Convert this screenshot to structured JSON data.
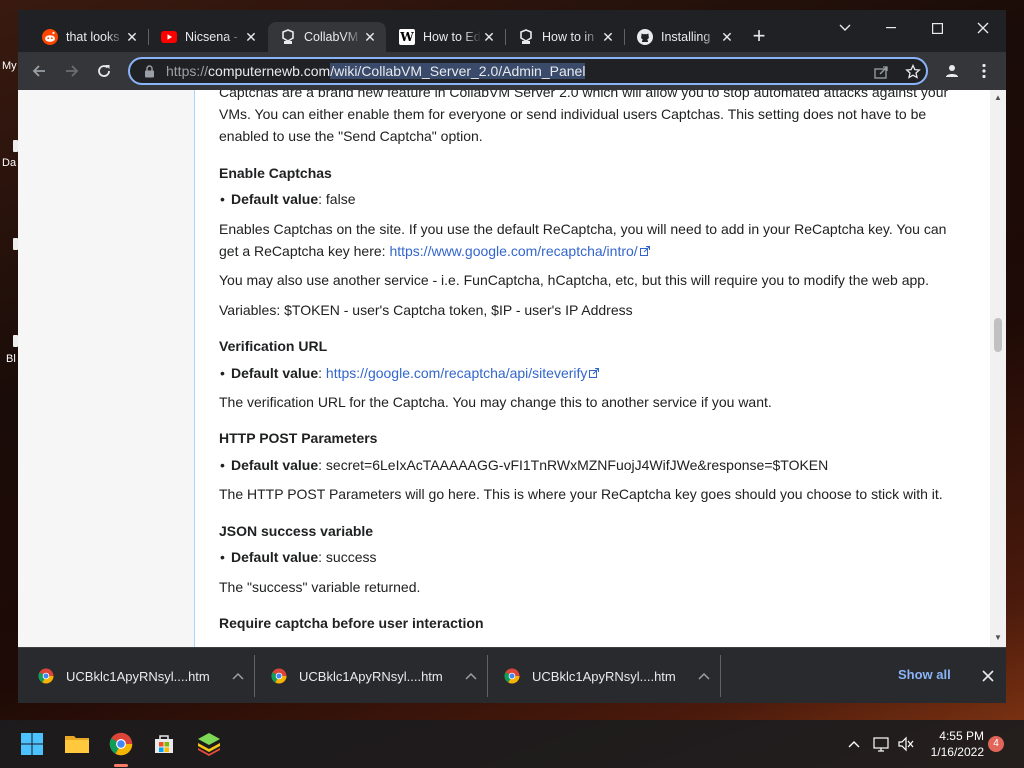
{
  "desktop": {
    "edge_labels": [
      "My",
      "Da",
      "Bl"
    ]
  },
  "tabs": [
    {
      "title": "that looks",
      "icon": "reddit-icon"
    },
    {
      "title": "Nicsena -",
      "icon": "youtube-icon"
    },
    {
      "title": "CollabVM",
      "icon": "collabvm-icon",
      "active": true
    },
    {
      "title": "How to Ed",
      "icon": "wikipedia-icon"
    },
    {
      "title": "How to in",
      "icon": "collabvm-icon"
    },
    {
      "title": "Installing",
      "icon": "github-icon"
    }
  ],
  "address_bar": {
    "scheme": "https://",
    "host": "computernewb.com",
    "path": "/wiki/CollabVM_Server_2.0/Admin_Panel"
  },
  "article": {
    "intro_line1": "Captchas are a brand new feature in CollabVM Server 2.0 which will allow you to stop automated attacks against your",
    "intro_line2": "VMs. You can either enable them for everyone or send individual users Captchas. This setting does not have to be",
    "intro_line3": "enabled to use the \"Send Captcha\" option.",
    "sections": {
      "enable": {
        "heading": "Enable Captchas",
        "default_label": "Default value",
        "default_value": ": false",
        "desc1": "Enables Captchas on the site. If you use the default ReCaptcha, you will need to add in your ReCaptcha key. You can",
        "desc2_text": "get a ReCaptcha key here: ",
        "desc2_link": "https://www.google.com/recaptcha/intro/",
        "desc3": "You may also use another service - i.e. FunCaptcha, hCaptcha, etc, but this will require you to modify the web app.",
        "desc4": "Variables: $TOKEN - user's Captcha token, $IP - user's IP Address"
      },
      "verify": {
        "heading": "Verification URL",
        "default_label": "Default value",
        "default_sep": ": ",
        "default_link": "https://google.com/recaptcha/api/siteverify",
        "desc": "The verification URL for the Captcha. You may change this to another service if you want."
      },
      "post": {
        "heading": "HTTP POST Parameters",
        "default_label": "Default value",
        "default_value": ": secret=6LeIxAcTAAAAAGG-vFI1TnRWxMZNFuojJ4WifJWe&response=$TOKEN",
        "desc": "The HTTP POST Parameters will go here. This is where your ReCaptcha key goes should you choose to stick with it."
      },
      "json": {
        "heading": "JSON success variable",
        "default_label": "Default value",
        "default_value": ": success",
        "desc": "The \"success\" variable returned."
      },
      "require": {
        "heading": "Require captcha before user interaction"
      }
    }
  },
  "downloads": [
    {
      "filename": "UCBklc1ApyRNsyl....htm"
    },
    {
      "filename": "UCBklc1ApyRNsyl....htm"
    },
    {
      "filename": "UCBklc1ApyRNsyl....htm"
    }
  ],
  "downloads_show_all": "Show all",
  "taskbar": {
    "time": "4:55 PM",
    "date": "1/16/2022",
    "notification_count": "4"
  },
  "colors": {
    "accent_link": "#3366cc",
    "omnibox_focus": "#8ab4f8",
    "chrome_dark": "#202124"
  }
}
